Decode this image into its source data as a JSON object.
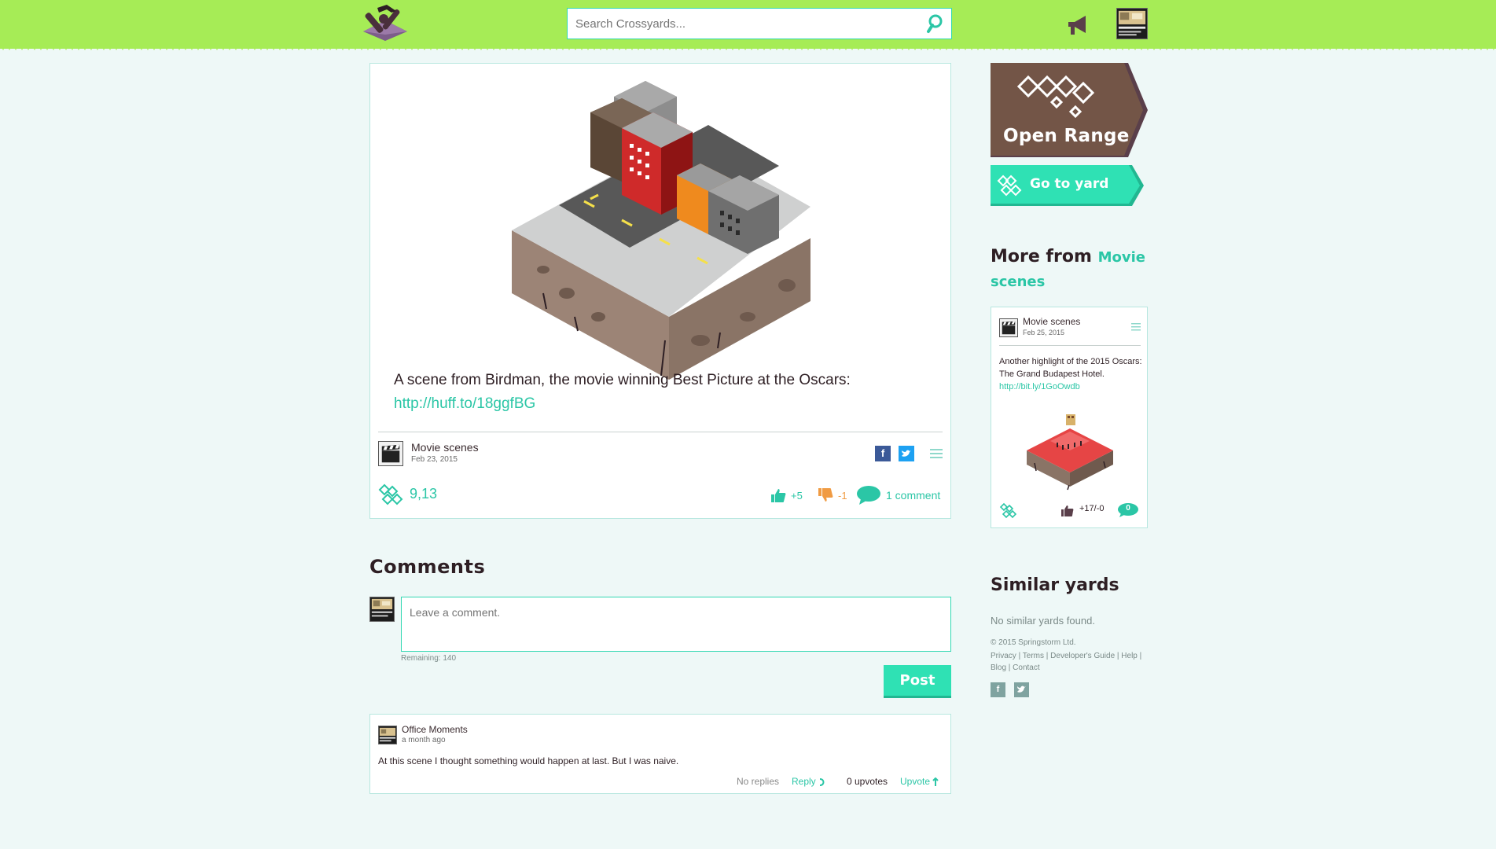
{
  "header": {
    "logo_icon": "crossyards-pickaxe-logo-icon",
    "search": {
      "placeholder": "Search Crossyards...",
      "value": ""
    },
    "search_icon": "search-icon",
    "notifications_icon": "megaphone-icon",
    "brand_color": "#a6ec56",
    "accent_color": "#2fe1b4"
  },
  "post": {
    "image": "isometric-city-street-scene",
    "text": "A scene from Birdman, the movie winning Best Picture at the Oscars:",
    "link": "http://huff.to/18ggfBG",
    "author": {
      "name": "Movie scenes",
      "date": "Feb 23, 2015"
    },
    "share": {
      "facebook": "f",
      "twitter_icon": "twitter-icon"
    },
    "plays": "9,13",
    "upvotes": "+5",
    "downvotes": "-1",
    "comment_count": "1 comment"
  },
  "comments": {
    "title": "Comments",
    "input_placeholder": "Leave a comment.",
    "remaining": "Remaining: 140",
    "post_button": "Post",
    "items": [
      {
        "author": "Office Moments",
        "time": "a month ago",
        "body": "At this scene I thought something would happen at last. But I was naive.",
        "replies": "No replies",
        "reply_label": "Reply",
        "upvotes": "0 upvotes",
        "upvote_label": "Upvote"
      }
    ]
  },
  "sidebar": {
    "open_range_label": "Open Range",
    "goto_yard_label": "Go to yard",
    "more_from_label": "More from",
    "more_from_category": "Movie scenes",
    "mini_post": {
      "author": "Movie scenes",
      "date": "Feb 25, 2015",
      "text": "Another highlight of the 2015 Oscars: The Grand Budapest Hotel.",
      "link": "http://bit.ly/1GoOwdb",
      "votes": "+17/-0",
      "comments": "0"
    },
    "similar_title": "Similar yards",
    "no_similar": "No similar yards found."
  },
  "footer": {
    "copyright": "© 2015 Springstorm Ltd.",
    "links": [
      "Privacy",
      "Terms",
      "Developer's Guide",
      "Help",
      "Blog",
      "Contact"
    ],
    "facebook": "f",
    "twitter_icon": "twitter-icon"
  }
}
